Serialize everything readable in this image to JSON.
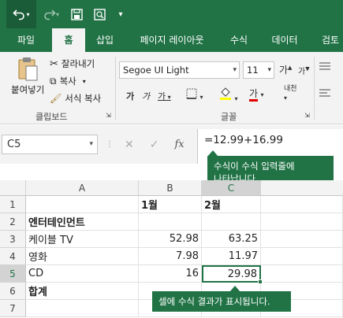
{
  "tabs": [
    {
      "label": "파일"
    },
    {
      "label": "홈"
    },
    {
      "label": "삽입"
    },
    {
      "label": "페이지 레이아웃"
    },
    {
      "label": "수식"
    },
    {
      "label": "데이터"
    },
    {
      "label": "검토"
    }
  ],
  "ribbon": {
    "clipboard": {
      "paste": "붙여넣기",
      "cut": "잘라내기",
      "copy": "복사",
      "format_painter": "서식 복사",
      "group": "클립보드"
    },
    "font": {
      "font_name": "Segoe UI Light",
      "font_size": "11",
      "group": "글꼴",
      "bold": "가",
      "italic": "가",
      "underline": "가",
      "grow": "가",
      "shrink": "가",
      "font_color": "가",
      "phonetic": "내천"
    }
  },
  "formula_bar": {
    "name_box": "C5",
    "fx": "fx",
    "formula": "=12.99+16.99"
  },
  "grid": {
    "columns": [
      "A",
      "B",
      "C"
    ],
    "rows": [
      {
        "num": "1",
        "a": "",
        "b": "1월",
        "c": "2월"
      },
      {
        "num": "2",
        "a": "엔터테인먼트",
        "b": "",
        "c": ""
      },
      {
        "num": "3",
        "a": "케이블 TV",
        "b": "52.98",
        "c": "63.25"
      },
      {
        "num": "4",
        "a": "영화",
        "b": "7.98",
        "c": "11.97"
      },
      {
        "num": "5",
        "a": "CD",
        "b": "16",
        "c": "29.98"
      },
      {
        "num": "6",
        "a": "합계",
        "b": "",
        "c": ""
      },
      {
        "num": "7",
        "a": "",
        "b": "",
        "c": ""
      }
    ]
  },
  "callouts": {
    "formula_callout": "수식이 수식 입력줄에\n나타납니다.",
    "cell_callout": "셀에 수식 결과가 표시됩니다."
  },
  "colors": {
    "accent": "#217346"
  }
}
